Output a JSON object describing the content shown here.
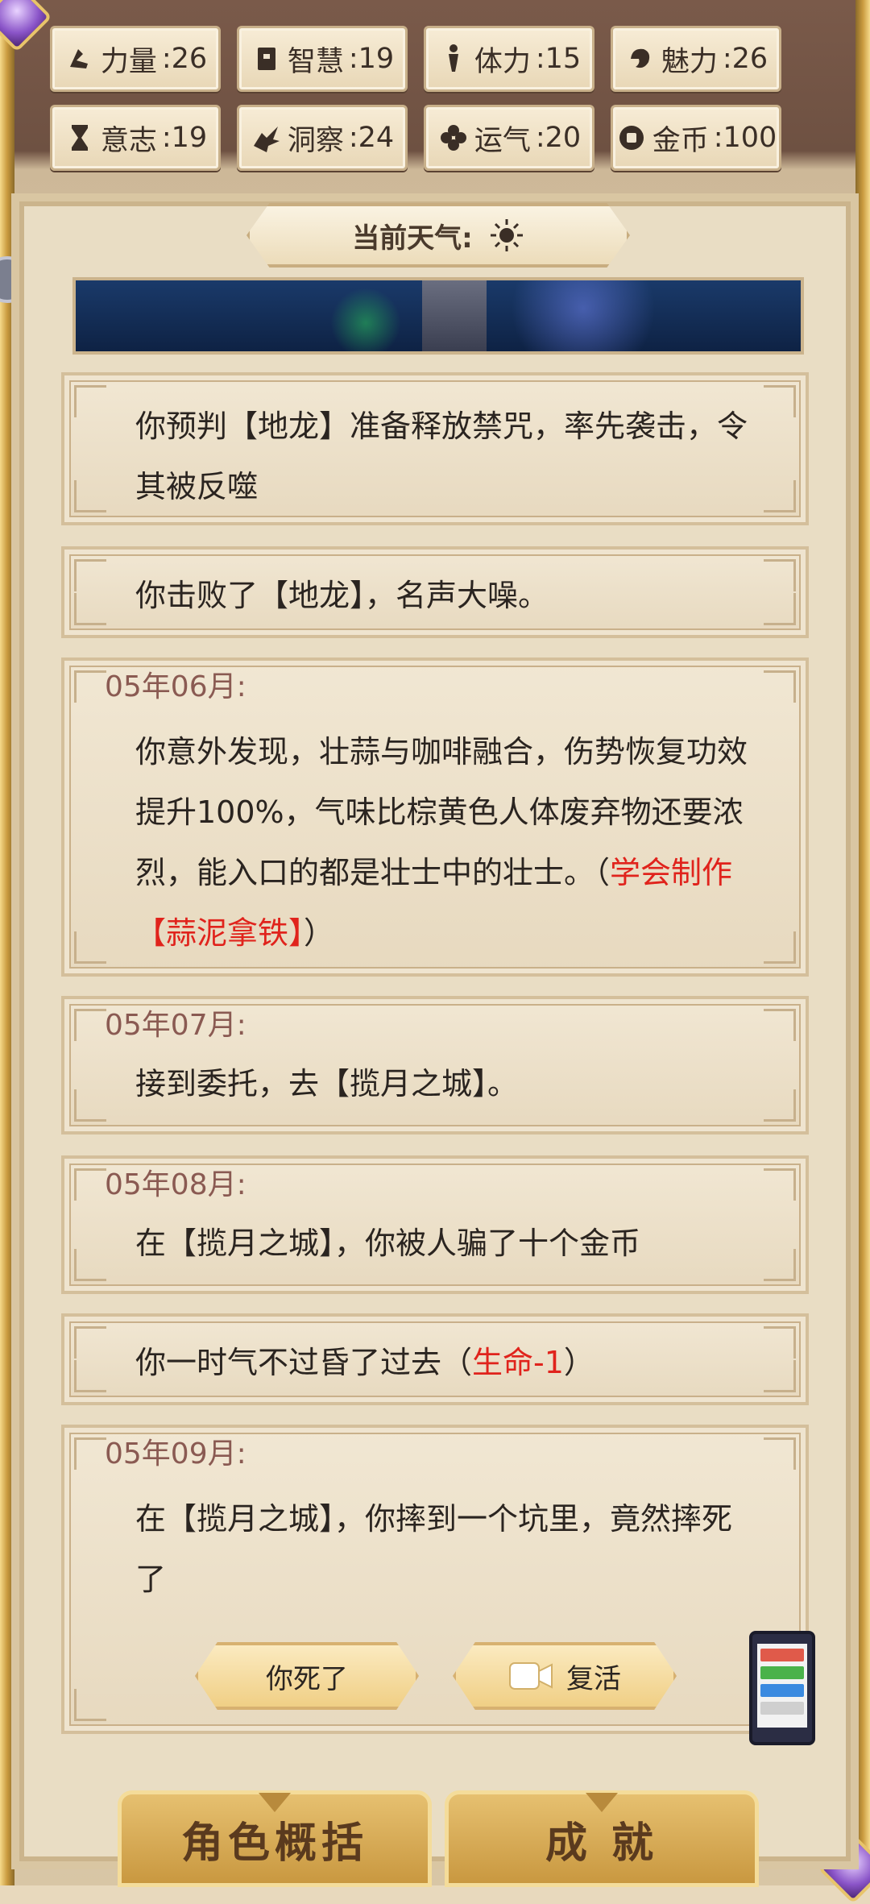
{
  "stats": [
    {
      "label": "力量",
      "value": ":26",
      "icon": "strength-icon"
    },
    {
      "label": "智慧",
      "value": ":19",
      "icon": "book-icon"
    },
    {
      "label": "体力",
      "value": ":15",
      "icon": "person-icon"
    },
    {
      "label": "魅力",
      "value": ":26",
      "icon": "charm-icon"
    },
    {
      "label": "意志",
      "value": ":19",
      "icon": "hourglass-icon"
    },
    {
      "label": "洞察",
      "value": ":24",
      "icon": "eagle-icon"
    },
    {
      "label": "运气",
      "value": ":20",
      "icon": "clover-icon"
    },
    {
      "label": "金币",
      "value": ":100",
      "icon": "coin-icon"
    }
  ],
  "weather": {
    "label": "当前天气:",
    "icon": "sun-icon"
  },
  "events": [
    {
      "date": "",
      "text": "你预判【地龙】准备释放禁咒，率先袭击，令其被反噬",
      "highlight": ""
    },
    {
      "date": "",
      "text": "你击败了【地龙】，名声大噪。",
      "highlight": ""
    },
    {
      "date": "05年06月:",
      "text": "你意外发现，壮蒜与咖啡融合，伤势恢复功效提升100%，气味比棕黄色人体废弃物还要浓烈，能入口的都是壮士中的壮士。（",
      "highlight": "学会制作【蒜泥拿铁】",
      "after": "）"
    },
    {
      "date": "05年07月:",
      "text": "接到委托，去【揽月之城】。",
      "highlight": ""
    },
    {
      "date": "05年08月:",
      "text": "在【揽月之城】，你被人骗了十个金币",
      "highlight": ""
    },
    {
      "date": "",
      "text": "你一时气不过昏了过去（",
      "highlight": "生命-1",
      "after": "）"
    },
    {
      "date": "05年09月:",
      "text": "在【揽月之城】，你摔到一个坑里，竟然摔死了",
      "highlight": ""
    }
  ],
  "buttons": {
    "dead": "你死了",
    "revive": "复活",
    "revive_icon": "video-icon"
  },
  "tabs": {
    "summary": "角色概括",
    "achievement": "成 就"
  },
  "colors": {
    "highlight": "#e0231c",
    "date": "#8a5a52",
    "gold": "#e6c070"
  }
}
